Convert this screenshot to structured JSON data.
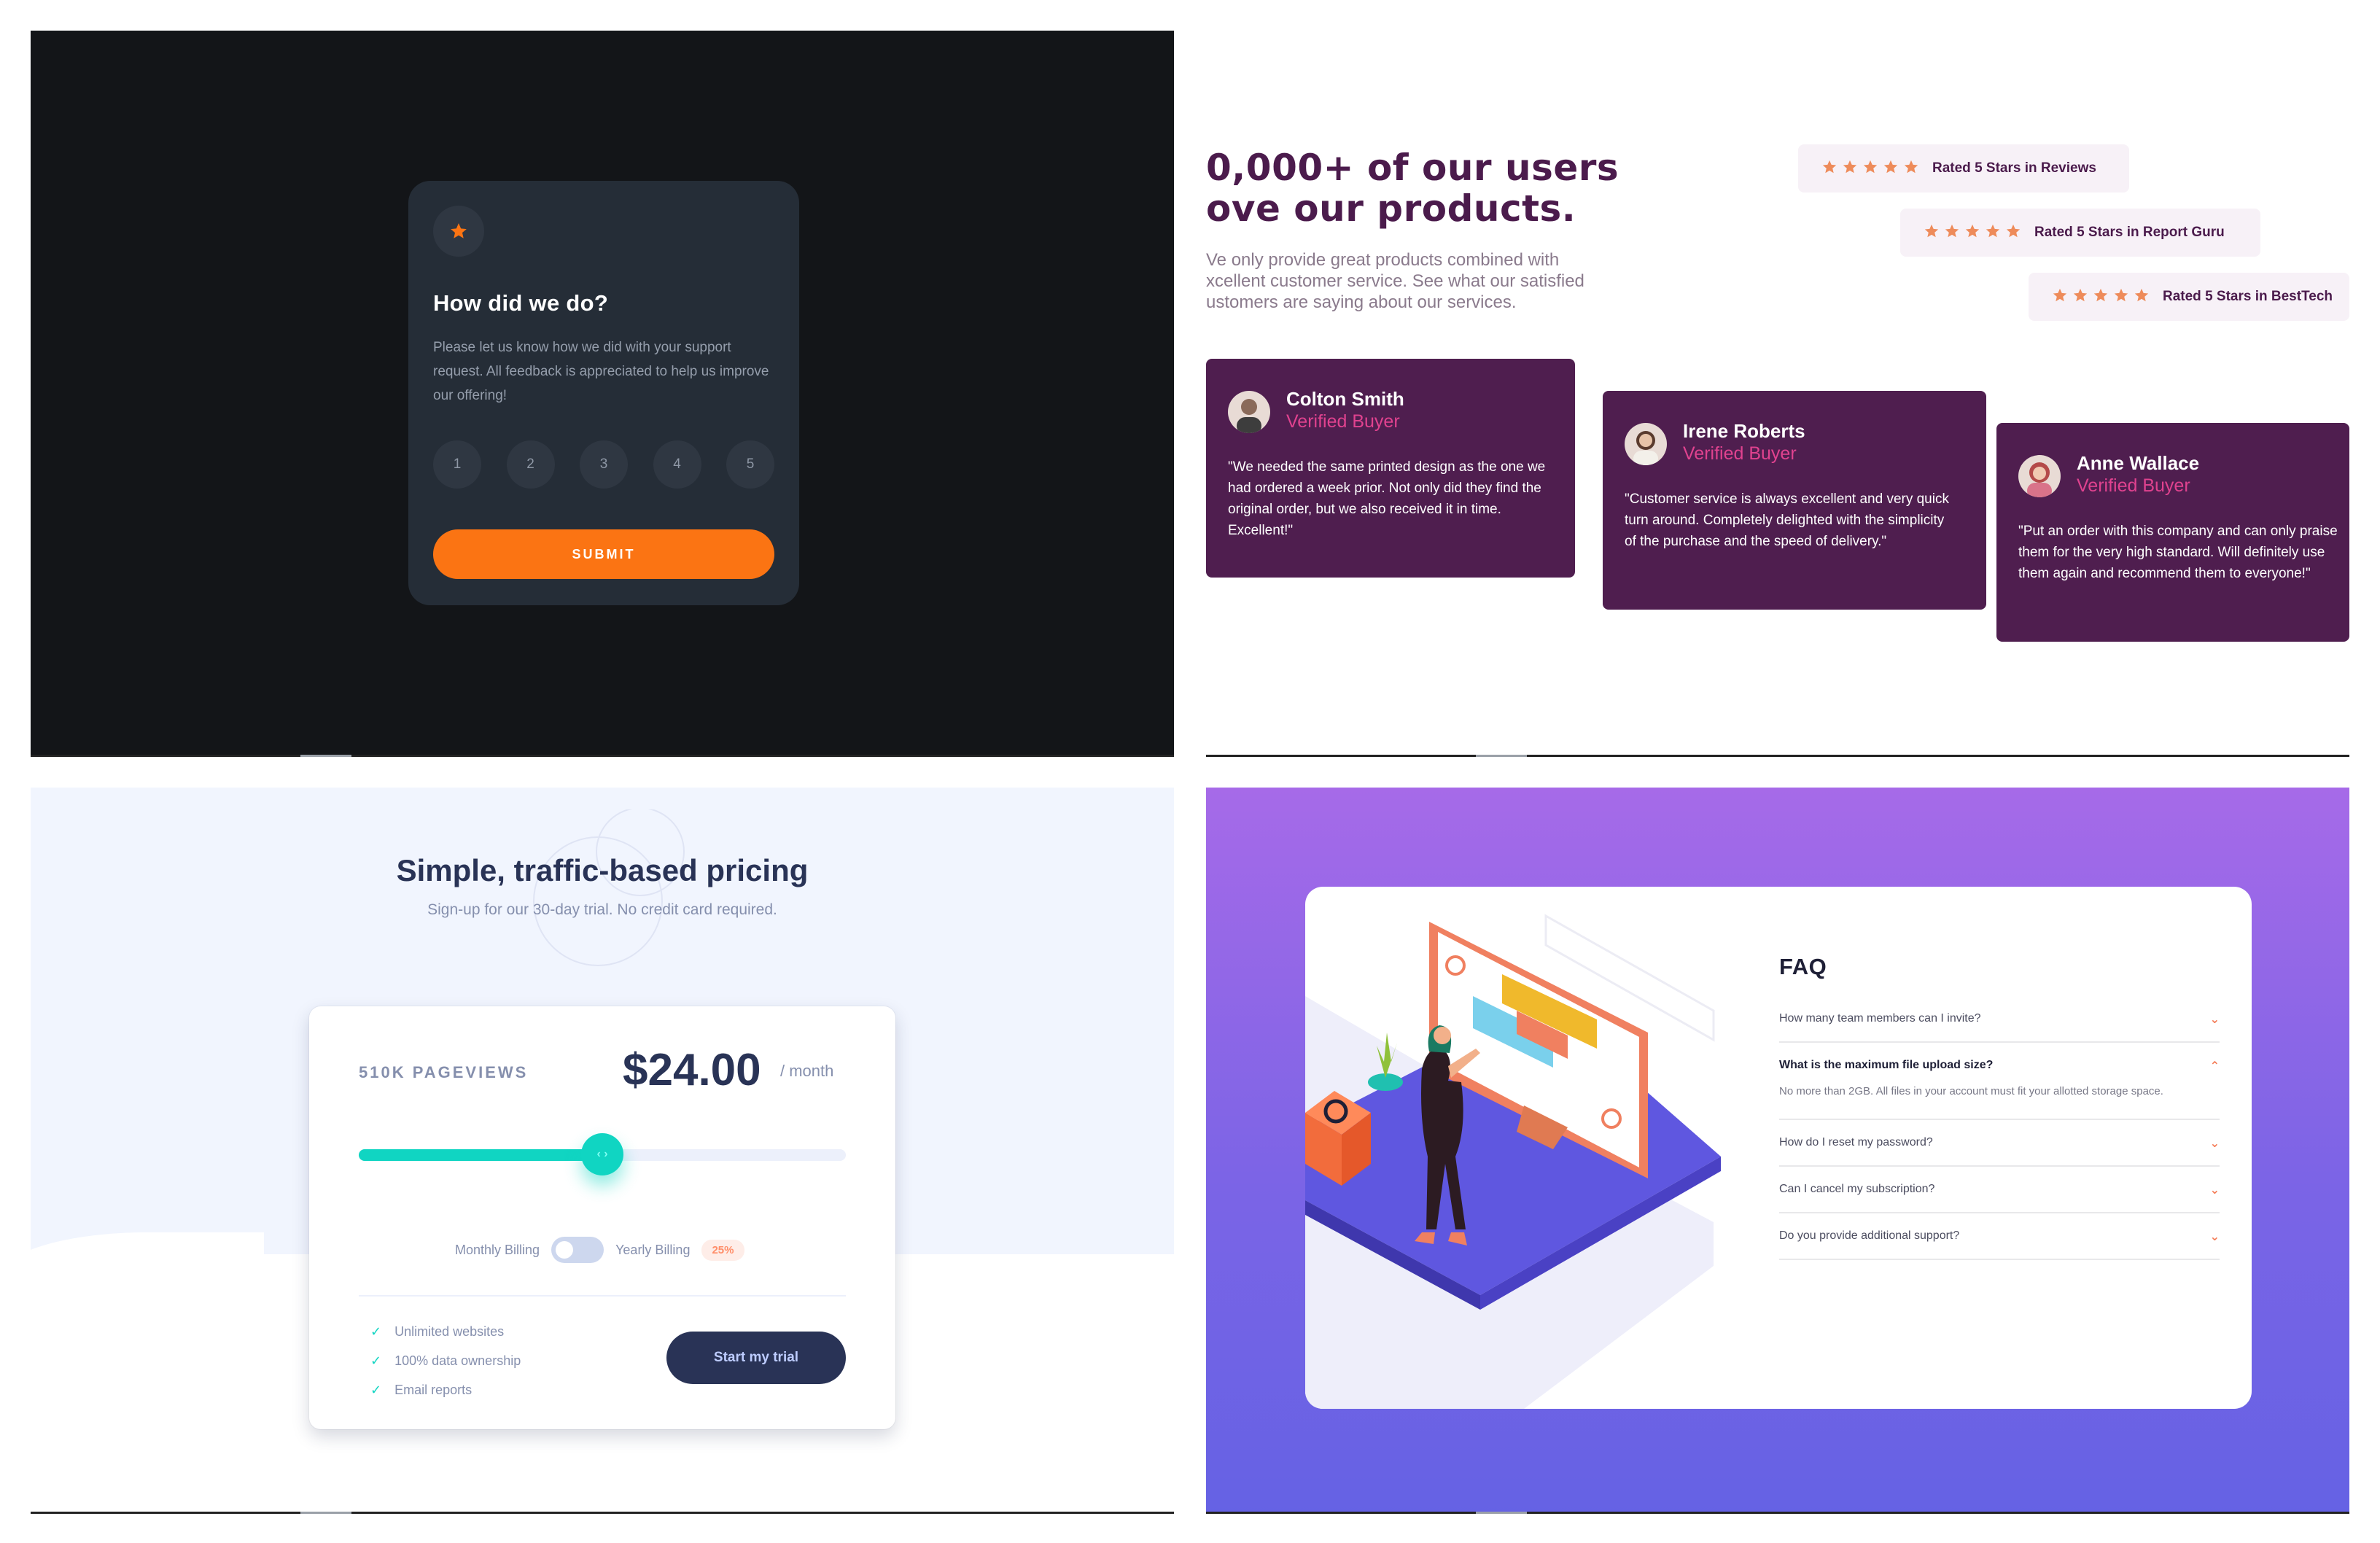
{
  "rating": {
    "title": "How did we do?",
    "body": "Please let us know how we did with your support request. All feedback is appreciated to help us improve our offering!",
    "options": [
      "1",
      "2",
      "3",
      "4",
      "5"
    ],
    "submit_label": "SUBMIT",
    "icon": "star-icon",
    "accent": "#fb7413"
  },
  "social": {
    "title": "0,000+ of our users\nove our products.",
    "subtitle": "Ve only provide great products combined with\nxcellent customer service. See what our satisfied\nustomers are saying about our services.",
    "badges": [
      {
        "label": "Rated 5 Stars in Reviews",
        "stars": 5
      },
      {
        "label": "Rated 5 Stars in Report Guru",
        "stars": 5
      },
      {
        "label": "Rated 5 Stars in BestTech",
        "stars": 5
      }
    ],
    "testimonials": [
      {
        "name": "Colton Smith",
        "tag": "Verified Buyer",
        "quote": "\"We needed the same printed design as the one we had ordered a week prior. Not only did they find the original order, but we also received it in time. Excellent!\""
      },
      {
        "name": "Irene Roberts",
        "tag": "Verified Buyer",
        "quote": "\"Customer service is always excellent and very quick turn around. Completely delighted with the simplicity of the purchase and the speed of delivery.\""
      },
      {
        "name": "Anne Wallace",
        "tag": "Verified Buyer",
        "quote": "\"Put an order with this company and can only praise them for the very high standard. Will definitely use them again and recommend them to everyone!\""
      }
    ],
    "accent": "#4b1b4c",
    "tag_color": "#e0428f"
  },
  "pricing": {
    "title": "Simple, traffic-based pricing",
    "subtitle": "Sign-up for our 30-day trial. No credit card required.",
    "pageviews": "510K PAGEVIEWS",
    "price": "$24.00",
    "period": "/ month",
    "slider_fraction": 0.5,
    "monthly_label": "Monthly Billing",
    "yearly_label": "Yearly Billing",
    "discount": "25%",
    "features": [
      "Unlimited websites",
      "100% data ownership",
      "Email reports"
    ],
    "cta": "Start my trial",
    "accent": "#10d5c2"
  },
  "faq": {
    "title": "FAQ",
    "items": [
      {
        "q": "How many team members can I invite?",
        "open": false,
        "a": ""
      },
      {
        "q": "What is the maximum file upload size?",
        "open": true,
        "a": "No more than 2GB. All files in your account must fit your allotted storage space."
      },
      {
        "q": "How do I reset my password?",
        "open": false,
        "a": ""
      },
      {
        "q": "Can I cancel my subscription?",
        "open": false,
        "a": ""
      },
      {
        "q": "Do you provide additional support?",
        "open": false,
        "a": ""
      }
    ],
    "accent": "#f47c57"
  }
}
